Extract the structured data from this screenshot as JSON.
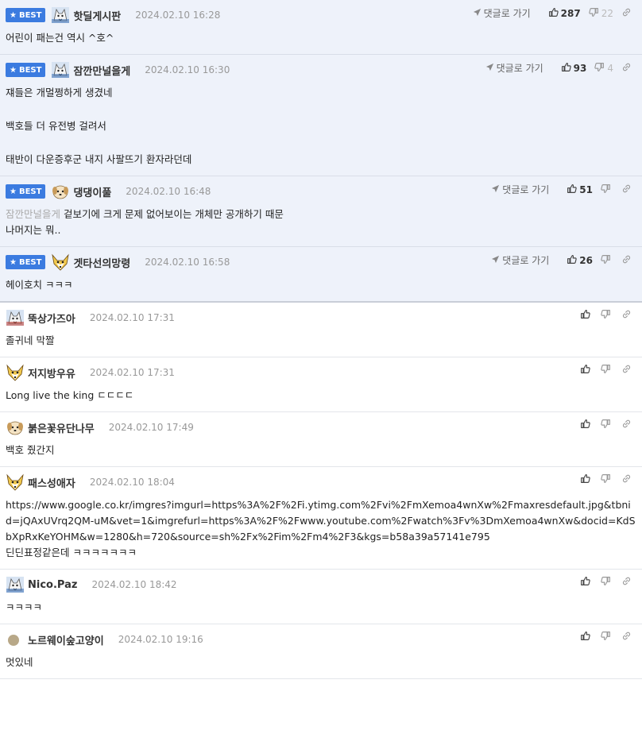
{
  "labels": {
    "best": "BEST",
    "reply": "댓글로 가기"
  },
  "best_comments": [
    {
      "nick": "핫딜게시판",
      "date": "2024.02.10 16:28",
      "avatar": "wolf-avatar-blue",
      "up": "287",
      "down": "22",
      "lines": [
        "어린이 패는건 역시 ^호^"
      ]
    },
    {
      "nick": "잠깐만널을게",
      "date": "2024.02.10 16:30",
      "avatar": "wolf-avatar-blue",
      "up": "93",
      "down": "4",
      "lines": [
        "쟤들은 개멀쩡하게 생겼네",
        "",
        "백호들 더 유전병 걸려서",
        "",
        "태반이 다운증후군 내지 사팔뜨기 환자라던데"
      ]
    },
    {
      "nick": "댕댕이풀",
      "date": "2024.02.10 16:48",
      "avatar": "dog-face-avatar",
      "up": "51",
      "down": "",
      "quote": "잠깐만널을게",
      "lines": [
        "겉보기에 크게 문제 없어보이는 개체만 공개하기 때문",
        "나머지는 뭐.."
      ]
    },
    {
      "nick": "겟타선의망령",
      "date": "2024.02.10 16:58",
      "avatar": "fox-face-avatar",
      "up": "26",
      "down": "",
      "lines": [
        "헤이호치 ㅋㅋㅋ"
      ]
    }
  ],
  "comments": [
    {
      "nick": "뚝상가즈아",
      "date": "2024.02.10 17:31",
      "avatar": "wolf-avatar-red",
      "lines": [
        "졸귀네 막짤"
      ]
    },
    {
      "nick": "저지방우유",
      "date": "2024.02.10 17:31",
      "avatar": "fox-face-avatar",
      "lines": [
        "Long live the king ㄷㄷㄷㄷ"
      ]
    },
    {
      "nick": "붉은꽃유단나무",
      "date": "2024.02.10 17:49",
      "avatar": "dog-face-avatar",
      "lines": [
        "백호 줬간지"
      ]
    },
    {
      "nick": "패스성애자",
      "date": "2024.02.10 18:04",
      "avatar": "fox-face-avatar",
      "url": "https://www.google.co.kr/imgres?imgurl=https%3A%2F%2Fi.ytimg.com%2Fvi%2FmXemoa4wnXw%2Fmaxresdefault.jpg&tbnid=jQAxUVrq2QM-uM&vet=1&imgrefurl=https%3A%2F%2Fwww.youtube.com%2Fwatch%3Fv%3DmXemoa4wnXw&docid=KdSbXpRxKeYOHM&w=1280&h=720&source=sh%2Fx%2Fim%2Fm4%2F3&kgs=b58a39a57141e795",
      "lines": [
        "딘딘표정같은데 ㅋㅋㅋㅋㅋㅋㅋ"
      ]
    },
    {
      "nick": "Nico.Paz",
      "date": "2024.02.10 18:42",
      "avatar": "wolf-avatar-blue",
      "lines": [
        "ㅋㅋㅋㅋ"
      ]
    },
    {
      "nick": "노르웨이숲고양이",
      "date": "2024.02.10 19:16",
      "avatar": "circle-avatar-tan",
      "lines": [
        "멋있네"
      ]
    }
  ],
  "colors": {
    "best_bg": "#eef2fa",
    "badge": "#3b7be0",
    "date": "#999999",
    "quote": "#aaaaaa"
  }
}
